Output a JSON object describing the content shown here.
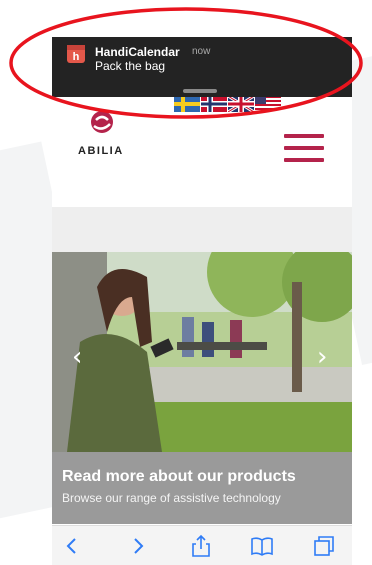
{
  "notification": {
    "app_name": "HandiCalendar",
    "time": "now",
    "message": "Pack the bag",
    "icon": "handicalendar-app-icon"
  },
  "header": {
    "logo_text": "ABILIA",
    "flags": [
      "sweden-flag",
      "norway-flag",
      "uk-flag",
      "usa-flag"
    ],
    "menu_icon": "hamburger-menu-icon"
  },
  "hero": {
    "title": "Read more about our products",
    "subtitle": "Browse our range of assistive technology",
    "prev_icon": "chevron-left-icon",
    "next_icon": "chevron-right-icon"
  },
  "toolbar": {
    "items": [
      "back-icon",
      "forward-icon",
      "share-icon",
      "bookmarks-icon",
      "tabs-icon"
    ]
  },
  "colors": {
    "brand": "#b4234b",
    "notification_bg": "#232323",
    "highlight": "#e8141e"
  }
}
